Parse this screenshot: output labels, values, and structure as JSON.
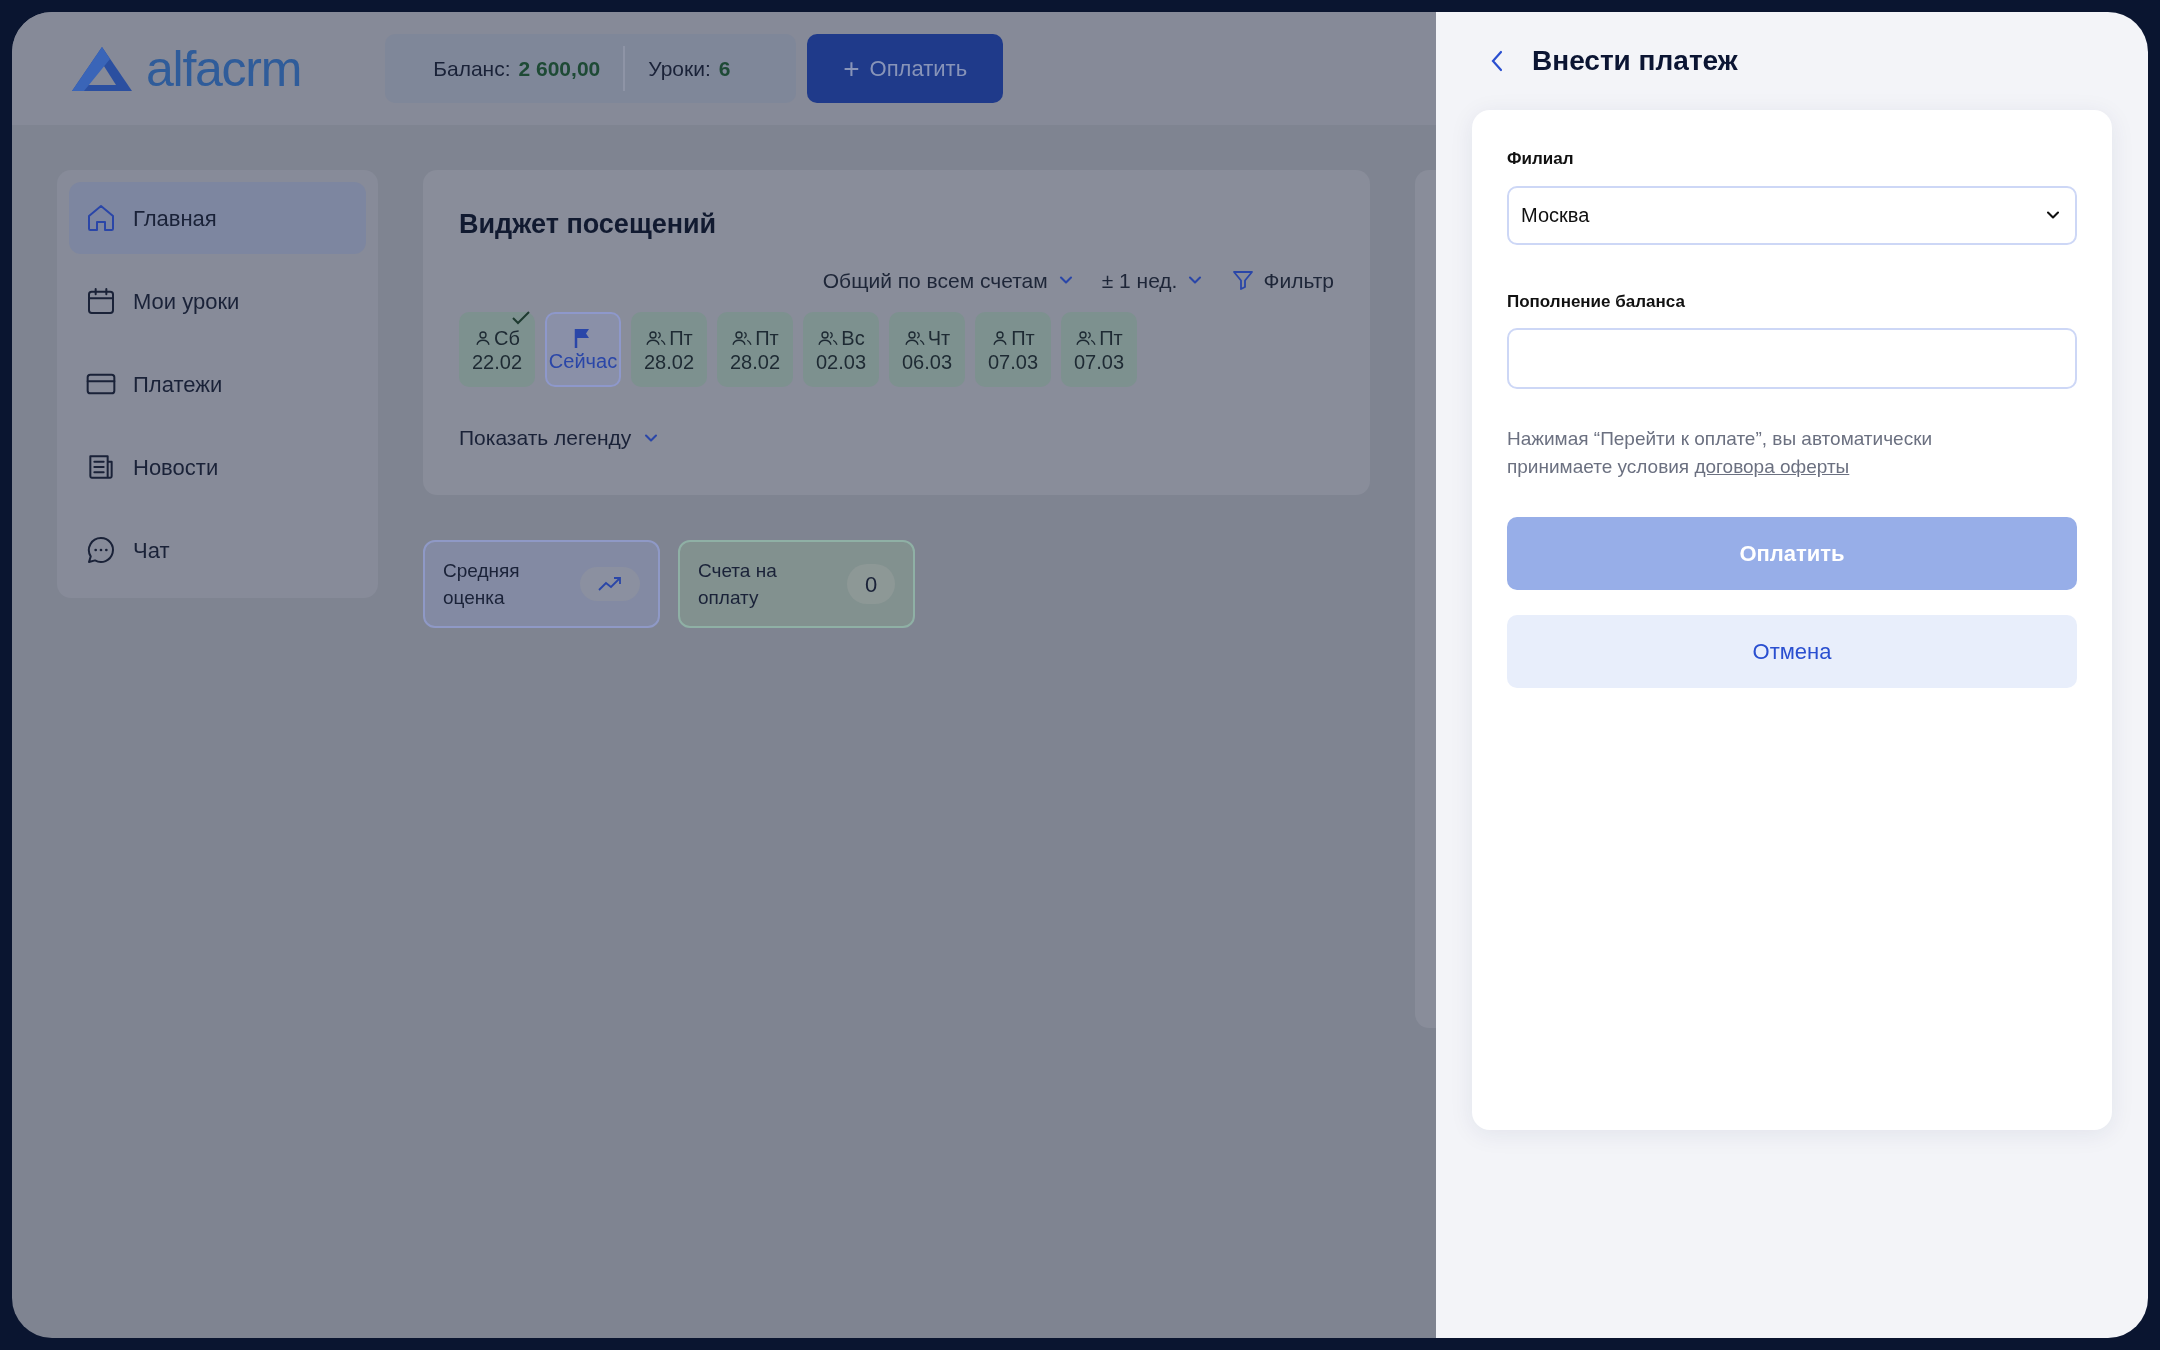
{
  "header": {
    "logo": "alfacrm",
    "balance": {
      "label": "Баланс:",
      "value": "2 600,00"
    },
    "lessons": {
      "label": "Уроки:",
      "value": "6"
    },
    "pay_button": {
      "icon": "+",
      "label": "Оплатить"
    }
  },
  "sidebar": {
    "items": [
      {
        "label": "Главная",
        "selected": true
      },
      {
        "label": "Мои уроки",
        "selected": false
      },
      {
        "label": "Платежи",
        "selected": false
      },
      {
        "label": "Новости",
        "selected": false
      },
      {
        "label": "Чат",
        "selected": false
      }
    ]
  },
  "widget": {
    "title": "Виджет посещений",
    "account_filter": "Общий по всем счетам",
    "period": "± 1 нед.",
    "filter": "Фильтр",
    "legend_toggle": "Показать легенду",
    "days": [
      {
        "kind": "individual",
        "day": "Сб",
        "date": "22.02",
        "attended": true,
        "selected": false
      },
      {
        "kind": "now",
        "date": "Сейчас",
        "selected": true
      },
      {
        "kind": "group",
        "day": "Пт",
        "date": "28.02",
        "attended": false,
        "selected": false
      },
      {
        "kind": "group",
        "day": "Пт",
        "date": "28.02",
        "attended": false,
        "selected": false
      },
      {
        "kind": "group",
        "day": "Вс",
        "date": "02.03",
        "attended": false,
        "selected": false
      },
      {
        "kind": "group",
        "day": "Чт",
        "date": "06.03",
        "attended": false,
        "selected": false
      },
      {
        "kind": "individual",
        "day": "Пт",
        "date": "07.03",
        "attended": false,
        "selected": false
      },
      {
        "kind": "group",
        "day": "Пт",
        "date": "07.03",
        "attended": false,
        "selected": false
      }
    ]
  },
  "stats": [
    {
      "kind": "trend",
      "label": "Средняя оценка"
    },
    {
      "kind": "count",
      "label": "Счета на оплату",
      "count": "0"
    }
  ],
  "drawer": {
    "title": "Внести платеж",
    "branch": {
      "label": "Филиал",
      "value": "Москва"
    },
    "amount": {
      "label": "Пополнение баланса"
    },
    "notice": "Нажимая “Перейти к оплате”, вы автоматически принимаете условия",
    "notice_link": "договора оферты",
    "submit": {
      "label": "Оплатить",
      "disabled": true
    },
    "cancel": "Отмена"
  }
}
